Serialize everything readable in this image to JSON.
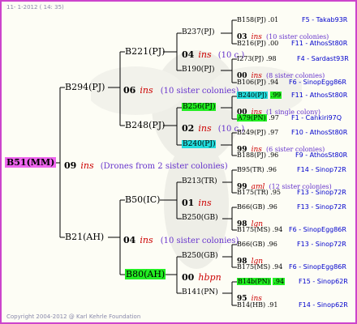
{
  "header": "11-  1-2012 ( 14: 35)",
  "footer": "Copyright 2004-2012 @ Karl Kehrle Foundation",
  "root": {
    "id": "B51(MM)",
    "gen_num": "09",
    "gen_ins": "ins",
    "note": "(Drones from 2 sister colonies)"
  },
  "l1": [
    {
      "id": "B294(PJ)",
      "gen_num": "06",
      "gen_ins": "ins",
      "note": "(10 sister colonies)"
    },
    {
      "id": "B21(AH)",
      "gen_num": "04",
      "gen_ins": "ins",
      "note": "(10 sister colonies)"
    }
  ],
  "l2": [
    {
      "id": "B221(PJ)",
      "gen_num": "04",
      "gen_ins": "ins",
      "note": "(10 c.)"
    },
    {
      "id": "B248(PJ)",
      "gen_num": "02",
      "gen_ins": "ins",
      "note": "(10 c.)"
    },
    {
      "id": "B50(IC)",
      "gen_num": "01",
      "gen_ins": "ins",
      "note": ""
    },
    {
      "id": "B80(AH)",
      "gen_num": "00",
      "gen_ins": "hbpn",
      "note": ""
    }
  ],
  "l3": [
    {
      "id": "B237(PJ)"
    },
    {
      "id": "B190(PJ)"
    },
    {
      "id": "B256(PJ)"
    },
    {
      "id": "B240(PJ)"
    },
    {
      "id": "B213(TR)"
    },
    {
      "id": "B250(GB)"
    },
    {
      "id": "B250(GB)"
    },
    {
      "id": "B141(PN)"
    }
  ],
  "l4": [
    {
      "id": "B158(PJ)",
      "val": ".01",
      "src": "F5 - Takab93R"
    },
    {
      "gen_num": "03",
      "gen_ins": "ins",
      "note": "(10 sister colonies)"
    },
    {
      "id": "B216(PJ)",
      "val": ".00",
      "src": "F11 - AthosSt80R"
    },
    {
      "id": "I273(PJ)",
      "val": ".98",
      "src": "F4 - Sardast93R"
    },
    {
      "gen_num": "00",
      "gen_ins": "ins",
      "note": "(8 sister colonies)"
    },
    {
      "id": "B106(PJ)",
      "val": ".94",
      "src": "F6 - SinopEgg86R"
    },
    {
      "id": "B240(PJ)",
      "val": ".99",
      "src": "F11 - AthosSt80R"
    },
    {
      "gen_num": "00",
      "gen_ins": "ins",
      "note": "(1 single colony)"
    },
    {
      "id": "A79(PN)",
      "val": ".97",
      "src": "F1 - Cankiri97Q"
    },
    {
      "id": "B249(PJ)",
      "val": ".97",
      "src": "F10 - AthosSt80R"
    },
    {
      "gen_num": "99",
      "gen_ins": "ins",
      "note": "(6 sister colonies)"
    },
    {
      "id": "B188(PJ)",
      "val": ".96",
      "src": "F9 - AthosSt80R"
    },
    {
      "id": "B95(TR)",
      "val": ".96",
      "src": "F14 - Sinop72R"
    },
    {
      "gen_num": "99",
      "gen_ins": "aml",
      "note": "(12 sister colonies)"
    },
    {
      "id": "B175(TR)",
      "val": ".95",
      "src": "F13 - Sinop72R"
    },
    {
      "id": "B66(GB)",
      "val": ".96",
      "src": "F13 - Sinop72R"
    },
    {
      "gen_num": "98",
      "gen_ins": "lgn",
      "note": ""
    },
    {
      "id": "B175(MS)",
      "val": ".94",
      "src": "F6 - SinopEgg86R"
    },
    {
      "id": "B66(GB)",
      "val": ".96",
      "src": "F13 - Sinop72R"
    },
    {
      "gen_num": "98",
      "gen_ins": "lgn",
      "note": ""
    },
    {
      "id": "B175(MS)",
      "val": ".94",
      "src": "F6 - SinopEgg86R"
    },
    {
      "id": "B14b(PN)",
      "val": ".94",
      "src": "F15 - Sinop62R"
    },
    {
      "gen_num": "95",
      "gen_ins": "ins",
      "note": ""
    },
    {
      "id": "B14(HB)",
      "val": ".91",
      "src": "F14 - Sinop62R"
    }
  ]
}
